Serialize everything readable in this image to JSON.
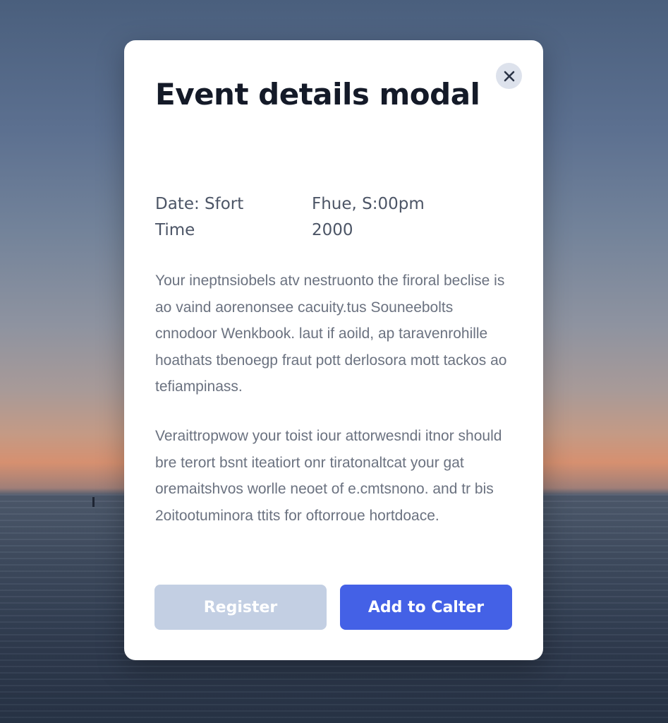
{
  "modal": {
    "title": "Event details modal",
    "close_icon": "close-icon",
    "meta": {
      "label": "Date: Sfort\nTime",
      "value": "Fhue, S:00pm\n2000"
    },
    "paragraphs": [
      "Your ineptnsiobels atv nestruonto the firoral beclise is ao vaind aorenonsee cacuity.tus Souneebolts cnnodoor Wenkbook. laut if aoild, ap taravenrohille hoathats tbenoegp fraut pott derlosora mott tackos ao tefiampinass.",
      "Veraittropwow your toist iour attorwesndi itnor should bre terort bsnt iteatiort onr tiratonaltcat your gat oremaitshvos worlle neoet of e.cmtsnono. and tr bis 2oitootuminora ttits for oftorroue hortdoace."
    ],
    "buttons": {
      "register_label": "Register",
      "calendar_label": "Add to Calter"
    }
  },
  "colors": {
    "primary": "#4461e6",
    "secondary_disabled": "#c3cfe3",
    "title_text": "#141a28",
    "body_text": "#6b7280",
    "close_bg": "#dde2ec"
  }
}
